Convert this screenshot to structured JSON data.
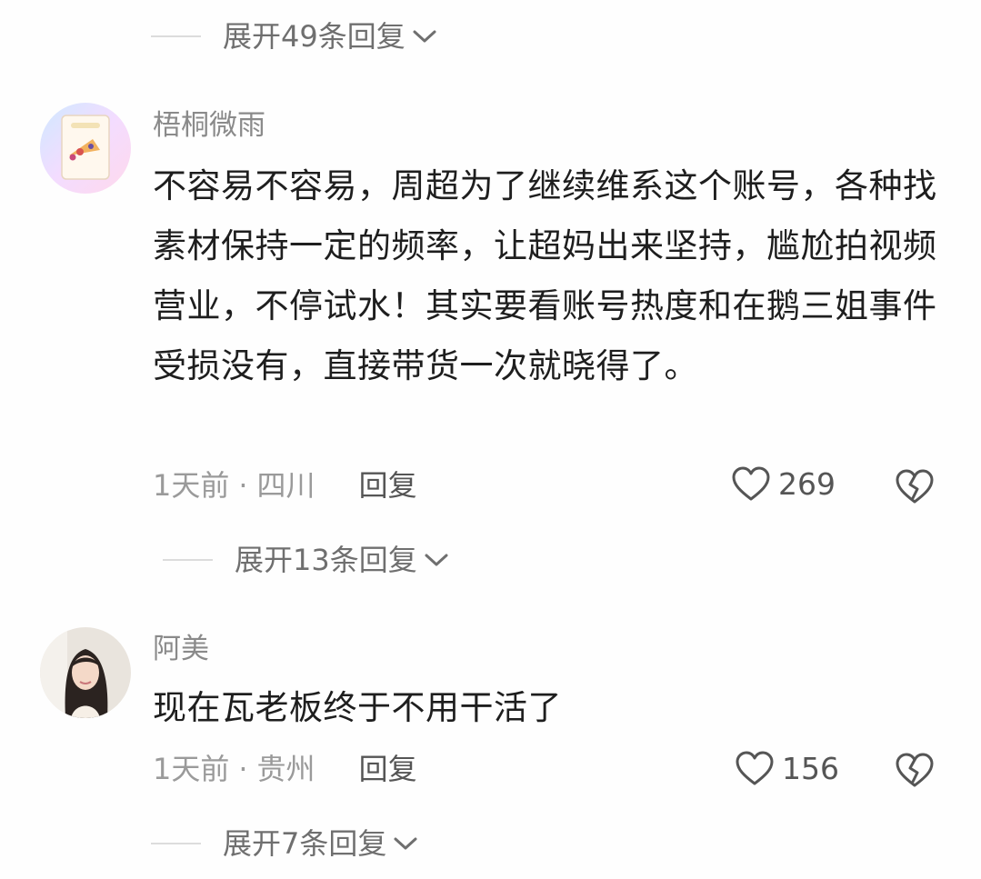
{
  "top_expand": {
    "label": "展开49条回复"
  },
  "comments": [
    {
      "username": "梧桐微雨",
      "text": "不容易不容易，周超为了继续维系这个账号，各种找素材保持一定的频率，让超妈出来坚持，尴尬拍视频营业，不停试水！其实要看账号热度和在鹅三姐事件受损没有，直接带货一次就晓得了。",
      "time": "1天前",
      "dot": "·",
      "location": "四川",
      "reply_label": "回复",
      "likes": "269",
      "expand_label": "展开13条回复"
    },
    {
      "username": "阿美",
      "text": "现在瓦老板终于不用干活了",
      "time": "1天前",
      "dot": "·",
      "location": "贵州",
      "reply_label": "回复",
      "likes": "156",
      "expand_label": "展开7条回复"
    }
  ],
  "icons": {
    "like": "heart-outline-icon",
    "dislike": "broken-heart-icon",
    "expand": "chevron-down-icon"
  },
  "colors": {
    "text": "#1e1e1e",
    "muted": "#9a9a9a",
    "secondary": "#6f6f6f",
    "background": "#fefefe"
  }
}
